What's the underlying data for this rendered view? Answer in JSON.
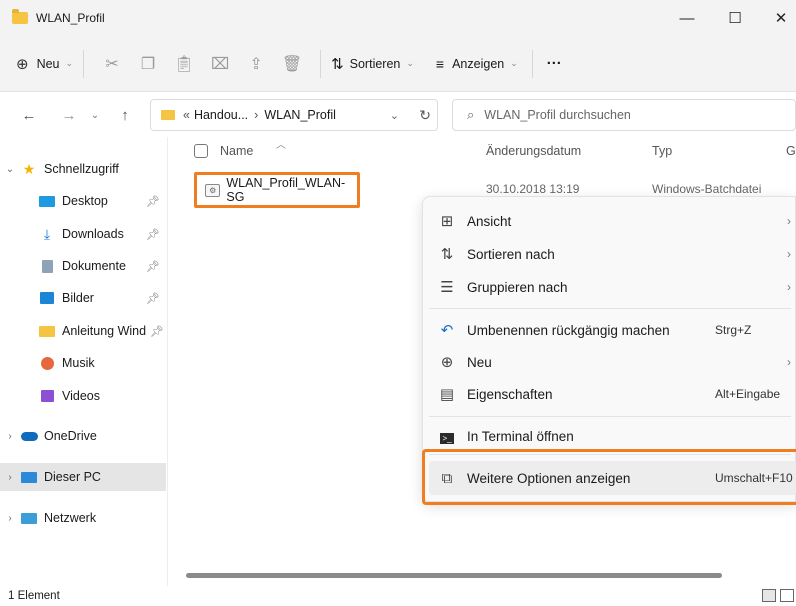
{
  "window": {
    "title": "WLAN_Profil",
    "minimize": "—",
    "maximize": "☐",
    "close": "✕"
  },
  "toolbar": {
    "new_label": "Neu",
    "sort_label": "Sortieren",
    "view_label": "Anzeigen",
    "more_label": "···"
  },
  "address": {
    "path_prefix": "«",
    "path_parent": "Handou...",
    "path_sep": "›",
    "path_current": "WLAN_Profil",
    "search_placeholder": "WLAN_Profil durchsuchen"
  },
  "sidebar": {
    "quick_access": "Schnellzugriff",
    "items": [
      {
        "label": "Desktop"
      },
      {
        "label": "Downloads"
      },
      {
        "label": "Dokumente"
      },
      {
        "label": "Bilder"
      },
      {
        "label": "Anleitung Wind"
      },
      {
        "label": "Musik"
      },
      {
        "label": "Videos"
      }
    ],
    "onedrive": "OneDrive",
    "this_pc": "Dieser PC",
    "network": "Netzwerk"
  },
  "columns": {
    "name": "Name",
    "date": "Änderungsdatum",
    "type": "Typ",
    "size": "G"
  },
  "file": {
    "name": "WLAN_Profil_WLAN-SG",
    "date": "30.10.2018 13:19",
    "type": "Windows-Batchdatei"
  },
  "context_menu": {
    "view": "Ansicht",
    "sort_by": "Sortieren nach",
    "group_by": "Gruppieren nach",
    "undo_rename": "Umbenennen rückgängig machen",
    "undo_shortcut": "Strg+Z",
    "new": "Neu",
    "properties": "Eigenschaften",
    "properties_shortcut": "Alt+Eingabe",
    "terminal": "In Terminal öffnen",
    "more_options": "Weitere Optionen anzeigen",
    "more_options_shortcut": "Umschalt+F10"
  },
  "status": {
    "count": "1 Element"
  },
  "colors": {
    "highlight": "#f07d1f",
    "folder": "#f5c443",
    "accent": "#0067c0"
  }
}
